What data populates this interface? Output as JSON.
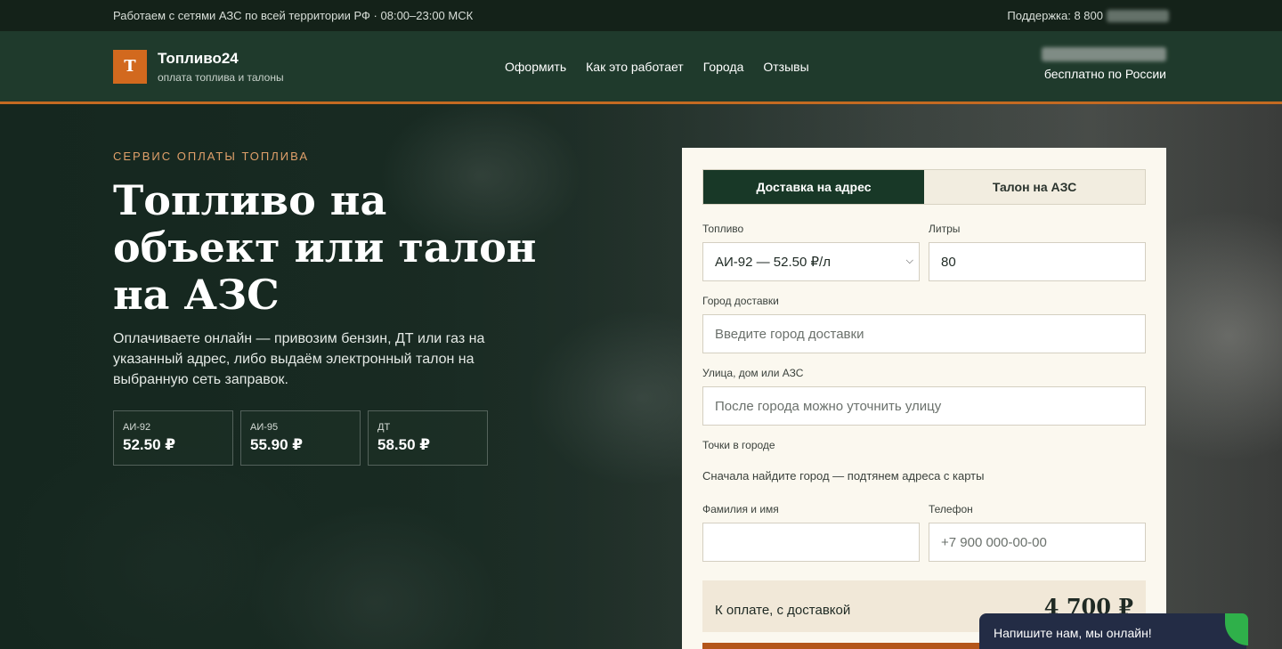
{
  "topbar": {
    "left": "Работаем с сетями АЗС по всей территории РФ · 08:00–23:00 МСК",
    "support": "Поддержка: 8 800"
  },
  "header": {
    "logo_letter": "Т",
    "brand": "Топливо24",
    "tagline": "оплата топлива и талоны",
    "nav": [
      "Оформить",
      "Как это работает",
      "Города",
      "Отзывы"
    ],
    "free_call": "бесплатно по России"
  },
  "hero": {
    "kicker": "СЕРВИС ОПЛАТЫ ТОПЛИВА",
    "title": "Топливо на объект или талон на АЗС",
    "text": "Оплачиваете онлайн — привозим бензин, ДТ или газ на указанный адрес, либо выдаём электронный талон на выбранную сеть заправок.",
    "prices": [
      {
        "label": "АИ-92",
        "value": "52.50 ₽"
      },
      {
        "label": "АИ-95",
        "value": "55.90 ₽"
      },
      {
        "label": "ДТ",
        "value": "58.50 ₽"
      }
    ]
  },
  "form": {
    "tabs": [
      "Доставка на адрес",
      "Талон на АЗС"
    ],
    "active_tab": 0,
    "fuel_label": "Топливо",
    "fuel_value": "АИ-92 — 52.50 ₽/л",
    "liters_label": "Литры",
    "liters_value": "80",
    "city_label": "Город доставки",
    "city_placeholder": "Введите город доставки",
    "street_label": "Улица, дом или АЗС",
    "street_placeholder": "После города можно уточнить улицу",
    "points_label": "Точки в городе",
    "points_hint": "Сначала найдите город — подтянем адреса с карты",
    "name_label": "Фамилия и имя",
    "name_value": "",
    "phone_label": "Телефон",
    "phone_placeholder": "+7 900 000-00-00",
    "total_label": "К оплате, с доставкой",
    "total_value": "4 700 ₽"
  },
  "chat": {
    "label": "Напишите нам, мы онлайн!"
  },
  "colors": {
    "brand_green": "#183827",
    "accent_orange": "#d2691e",
    "chat_bg": "#232c45"
  }
}
